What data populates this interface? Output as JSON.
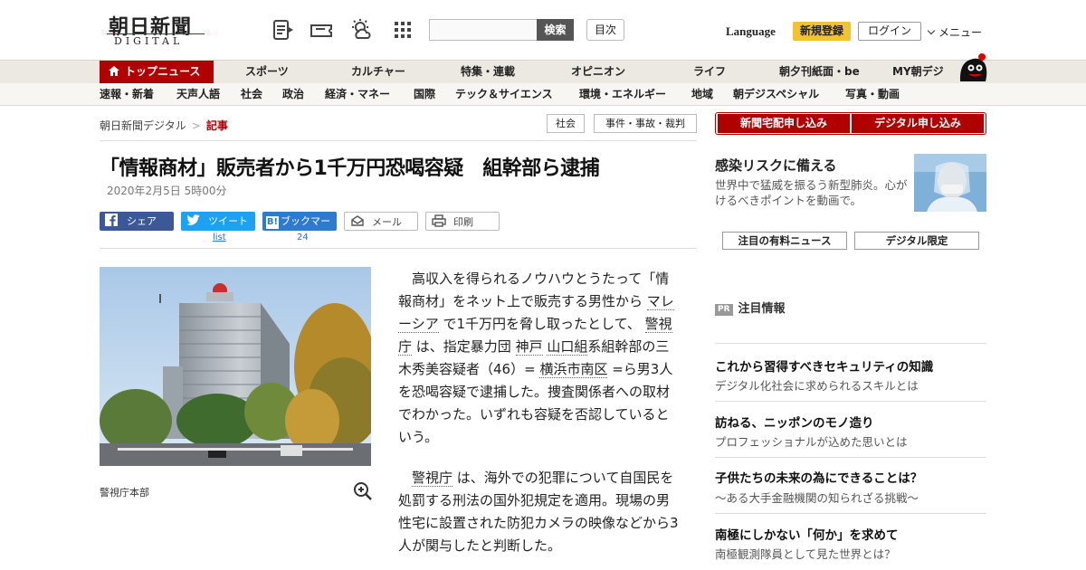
{
  "header": {
    "logo_main": "朝日新聞",
    "logo_sub": "DIGITAL",
    "search_button": "検索",
    "search_placeholder": "",
    "toc_button": "目次",
    "language": "Language",
    "signup": "新規登録",
    "login": "ログイン",
    "menu": "メニュー"
  },
  "main_nav": [
    "トップニュース",
    "スポーツ",
    "カルチャー",
    "特集・連載",
    "オピニオン",
    "ライフ",
    "朝夕刊紙面・be",
    "MY朝デジ"
  ],
  "sub_nav": [
    "速報・新着",
    "天声人語",
    "社会",
    "政治",
    "経済・マネー",
    "国際",
    "テック＆サイエンス",
    "環境・エネルギー",
    "地域",
    "朝デジスペシャル",
    "写真・動画"
  ],
  "breadcrumb": {
    "home": "朝日新聞デジタル",
    "current": "記事"
  },
  "category_tags": [
    "社会",
    "事件・事故・裁判"
  ],
  "article": {
    "title": "「情報商材」販売者から1千万円恐喝容疑　組幹部ら逮捕",
    "date": "2020年2月5日 5時00分",
    "photo_caption": "警視庁本部",
    "p1": {
      "a": "高収入を得られるノウハウとうたって「情報商材」をネット上で販売する男性から",
      "link1": "マレーシア",
      "b": "で1千万円を脅し取ったとして、",
      "link2": "警視庁",
      "c": "は、指定暴力団",
      "link3": "神戸",
      "link4": "山口組",
      "d": "系組幹部の三木秀美容疑者（46）=",
      "link5": "横浜市南区",
      "e": "=ら男3人を恐喝容疑で逮捕した。捜査関係者への取材でわかった。いずれも容疑を否認しているという。"
    },
    "p2": {
      "link1": "警視庁",
      "a": "は、海外での犯罪について自国民を処罰する刑法の国外犯規定を適用。現場の男性宅に設置された防犯カメラの映像などから3人が関与したと判断した。"
    }
  },
  "share": {
    "facebook": "シェア",
    "twitter": "ツイート",
    "twitter_count": "list",
    "hatena": "ブックマーク",
    "hatena_count": "24",
    "mail": "メール",
    "print": "印刷"
  },
  "sidebar": {
    "subscribe_paper": "新聞宅配申し込み",
    "subscribe_digital": "デジタル申し込み",
    "promo_title": "感染リスクに備える",
    "promo_desc": "世界中で猛威を振るう新型肺炎。心がけるべきポイントを動画で。",
    "tab1": "注目の有料ニュース",
    "tab2": "デジタル限定",
    "pr_badge": "PR",
    "pr_heading": "注目情報",
    "pr_items": [
      {
        "title": "これから習得すべきセキュリティの知識",
        "sub": "デジタル化社会に求められるスキルとは"
      },
      {
        "title": "訪ねる、ニッポンのモノ造り",
        "sub": "プロフェッショナルが込めた思いとは"
      },
      {
        "title": "子供たちの未来の為にできることは？",
        "sub": "～ある大手金融機関の知られざる挑戦～"
      },
      {
        "title": "南極にしかない「何か」を求めて",
        "sub": "南極観測隊員として見た世界とは？"
      }
    ]
  },
  "colors": {
    "brand_red": "#b00000",
    "signup_yellow": "#f1c232",
    "nav_bg": "#ece9e3"
  }
}
